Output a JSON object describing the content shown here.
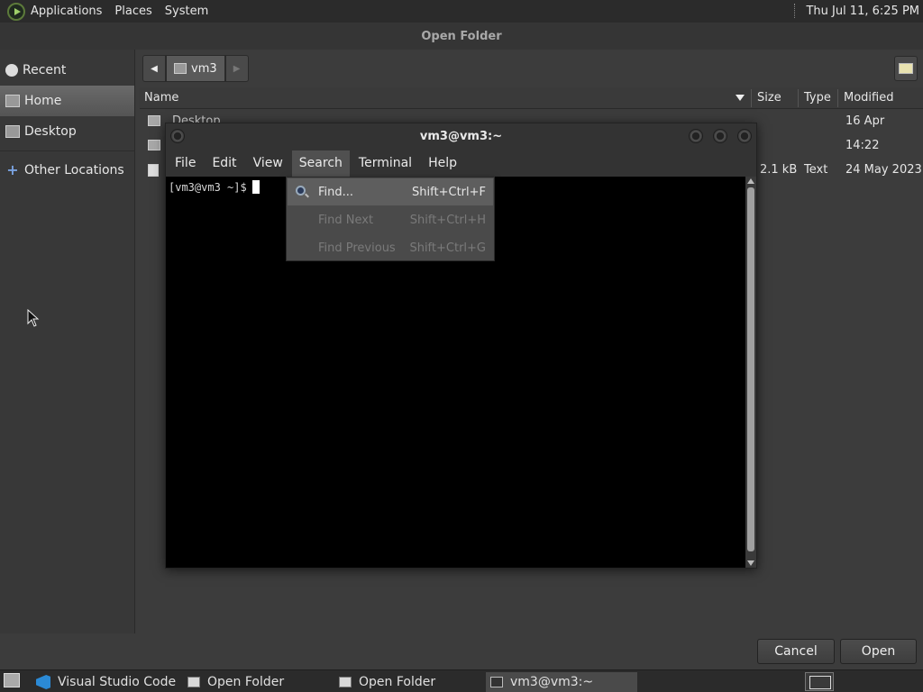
{
  "top_panel": {
    "menu": [
      "Applications",
      "Places",
      "System"
    ],
    "clock": "Thu Jul 11,  6:25 PM"
  },
  "dialog": {
    "title": "Open Folder",
    "cancel_label": "Cancel",
    "open_label": "Open"
  },
  "sidebar": {
    "items": [
      {
        "label": "Recent",
        "icon": "clock-icon"
      },
      {
        "label": "Home",
        "icon": "home-folder-icon"
      },
      {
        "label": "Desktop",
        "icon": "desktop-folder-icon"
      },
      {
        "label": "Other Locations",
        "icon": "plus-icon"
      }
    ],
    "active": "Home"
  },
  "path_bar": {
    "segment": "vm3"
  },
  "file_list": {
    "columns": [
      "Name",
      "Size",
      "Type",
      "Modified"
    ],
    "rows": [
      {
        "name": "Desktop",
        "size": "",
        "type": "",
        "modified": "16 Apr"
      },
      {
        "name": "",
        "size": "",
        "type": "",
        "modified": "14:22"
      },
      {
        "name": "",
        "size": "2.1 kB",
        "type": "Text",
        "modified": "24 May 2023"
      }
    ]
  },
  "terminal": {
    "title": "vm3@vm3:~",
    "menu": [
      "File",
      "Edit",
      "View",
      "Search",
      "Terminal",
      "Help"
    ],
    "open_menu": "Search",
    "prompt": "[vm3@vm3 ~]$"
  },
  "search_menu": {
    "items": [
      {
        "label": "Find...",
        "accel": "Shift+Ctrl+F",
        "enabled": true
      },
      {
        "label": "Find Next",
        "accel": "Shift+Ctrl+H",
        "enabled": false
      },
      {
        "label": "Find Previous",
        "accel": "Shift+Ctrl+G",
        "enabled": false
      }
    ]
  },
  "taskbar": {
    "tasks": [
      {
        "label": "Visual Studio Code",
        "icon": "vscode-icon"
      },
      {
        "label": "Open Folder",
        "icon": "window-icon"
      },
      {
        "label": "Open Folder",
        "icon": "window-icon"
      },
      {
        "label": "vm3@vm3:~",
        "icon": "terminal-icon",
        "active": true
      }
    ]
  }
}
